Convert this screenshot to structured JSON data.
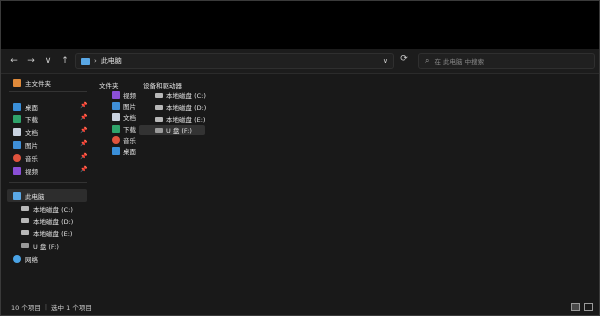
{
  "toolbar": {
    "back": "←",
    "forward": "→",
    "recent": "∨",
    "up": "↑",
    "refresh": "⟳"
  },
  "address": {
    "separator": "›",
    "path": "此电脑",
    "dropdown": "∨"
  },
  "search": {
    "placeholder": "在 此电脑 中搜索"
  },
  "sidebar": {
    "home": "主文件夹",
    "quick": [
      {
        "label": "桌面",
        "icon": "desktop-icon",
        "pinned": true
      },
      {
        "label": "下载",
        "icon": "download-icon",
        "pinned": true
      },
      {
        "label": "文档",
        "icon": "document-icon",
        "pinned": true
      },
      {
        "label": "图片",
        "icon": "pictures-icon",
        "pinned": true
      },
      {
        "label": "音乐",
        "icon": "music-icon",
        "pinned": true
      },
      {
        "label": "视频",
        "icon": "video-icon",
        "pinned": true
      }
    ],
    "pin_glyph": "📌",
    "this_pc": "此电脑",
    "drives": [
      {
        "label": "本地磁盘 (C:)"
      },
      {
        "label": "本地磁盘 (D:)"
      },
      {
        "label": "本地磁盘 (E:)"
      },
      {
        "label": "U 盘 (F:)"
      }
    ],
    "network": "网络"
  },
  "content": {
    "folders_header": "文件夹",
    "folders": [
      "视频",
      "图片",
      "文档",
      "下载",
      "音乐",
      "桌面"
    ],
    "devices_header": "设备和驱动器",
    "devices": [
      "本地磁盘 (C:)",
      "本地磁盘 (D:)",
      "本地磁盘 (E:)",
      "U 盘 (F:)"
    ]
  },
  "status": {
    "count": "10 个项目",
    "separator": "|",
    "selected": "选中 1 个项目"
  }
}
